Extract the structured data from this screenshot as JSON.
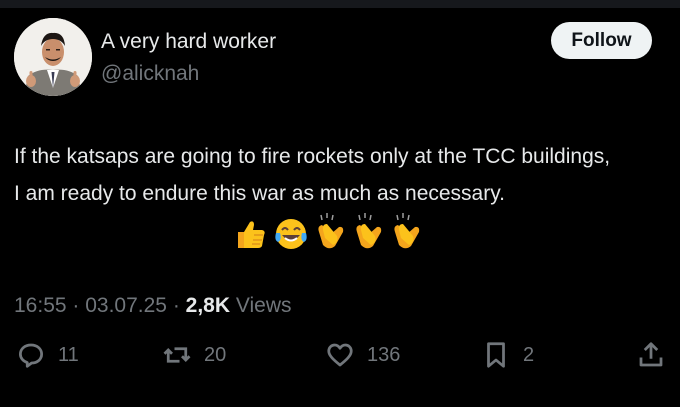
{
  "author": {
    "name": "A very hard worker",
    "handle": "@alicknah"
  },
  "follow_label": "Follow",
  "tweet": {
    "line1": "If the katsaps are going to fire rockets only at the TCC buildings,",
    "line2": "I am ready to endure this war as much as necessary.",
    "emojis": [
      "thumbs-up",
      "tears-of-joy",
      "clapping-hands",
      "clapping-hands",
      "clapping-hands"
    ]
  },
  "meta": {
    "time": "16:55",
    "date": "03.07.25",
    "views_count": "2,8K",
    "views_label": "Views"
  },
  "actions": {
    "replies": "11",
    "reposts": "20",
    "likes": "136",
    "bookmarks": "2"
  },
  "colors": {
    "background": "#000000",
    "text": "#e7e9ea",
    "secondary": "#71767b",
    "follow_bg": "#eff3f4"
  }
}
